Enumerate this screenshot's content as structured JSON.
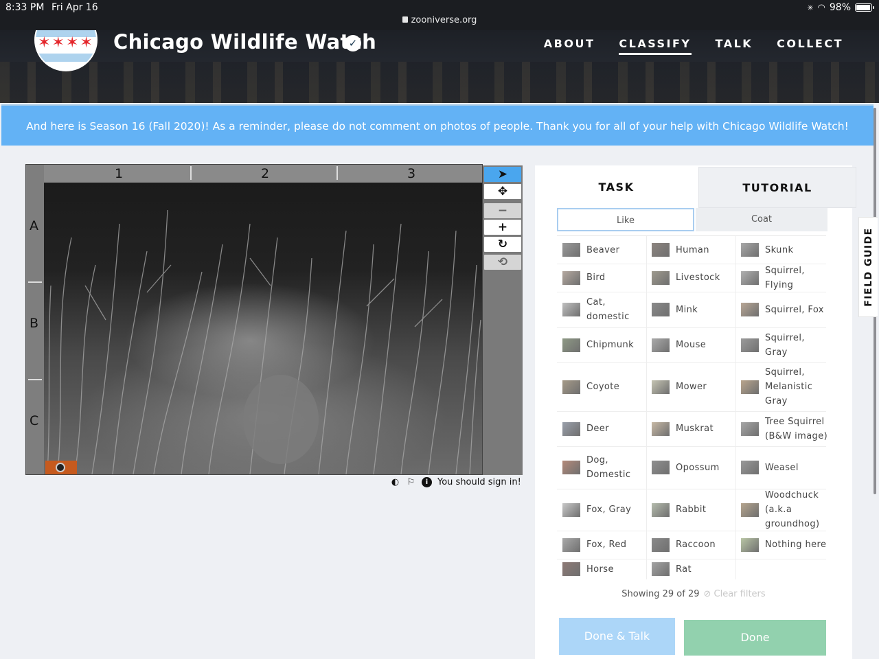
{
  "status_bar": {
    "time": "8:33 PM",
    "date": "Fri Apr 16",
    "url": "zooniverse.org",
    "battery": "98%",
    "battery_level": 0.98
  },
  "header": {
    "title": "Chicago Wildlife Watch",
    "nav": [
      {
        "label": "ABOUT",
        "active": false
      },
      {
        "label": "CLASSIFY",
        "active": true
      },
      {
        "label": "TALK",
        "active": false
      },
      {
        "label": "COLLECT",
        "active": false
      }
    ]
  },
  "announcement": "And here is Season 16 (Fall 2020)! As a reminder, please do not comment on photos of people. Thank you for all of your help with Chicago Wildlife Watch!",
  "viewer": {
    "columns": [
      "1",
      "2",
      "3"
    ],
    "rows": [
      "A",
      "B",
      "C"
    ],
    "sign_in_text": "You should sign in!"
  },
  "panel": {
    "tabs": {
      "task": "TASK",
      "tutorial": "TUTORIAL"
    },
    "filters": {
      "like": "Like",
      "coat": "Coat"
    },
    "species": [
      "Beaver",
      "Human",
      "Skunk",
      "Bird",
      "Livestock",
      "Squirrel, Flying",
      "Cat, domestic",
      "Mink",
      "Squirrel, Fox",
      "Chipmunk",
      "Mouse",
      "Squirrel, Gray",
      "Coyote",
      "Mower",
      "Squirrel, Melanistic Gray",
      "Deer",
      "Muskrat",
      "Tree Squirrel (B&W image)",
      "Dog, Domestic",
      "Opossum",
      "Weasel",
      "Fox, Gray",
      "Rabbit",
      "Woodchuck (a.k.a groundhog)",
      "Fox, Red",
      "Raccoon",
      "Nothing here",
      "Horse",
      "Rat"
    ],
    "showing": "Showing 29 of 29",
    "clear_filters": "Clear filters",
    "done_talk": "Done & Talk",
    "done": "Done"
  },
  "field_guide": "FIELD GUIDE",
  "colors": {
    "accent": "#63b2f5",
    "done": "#92d1ae",
    "done_talk": "#acd6f8"
  }
}
